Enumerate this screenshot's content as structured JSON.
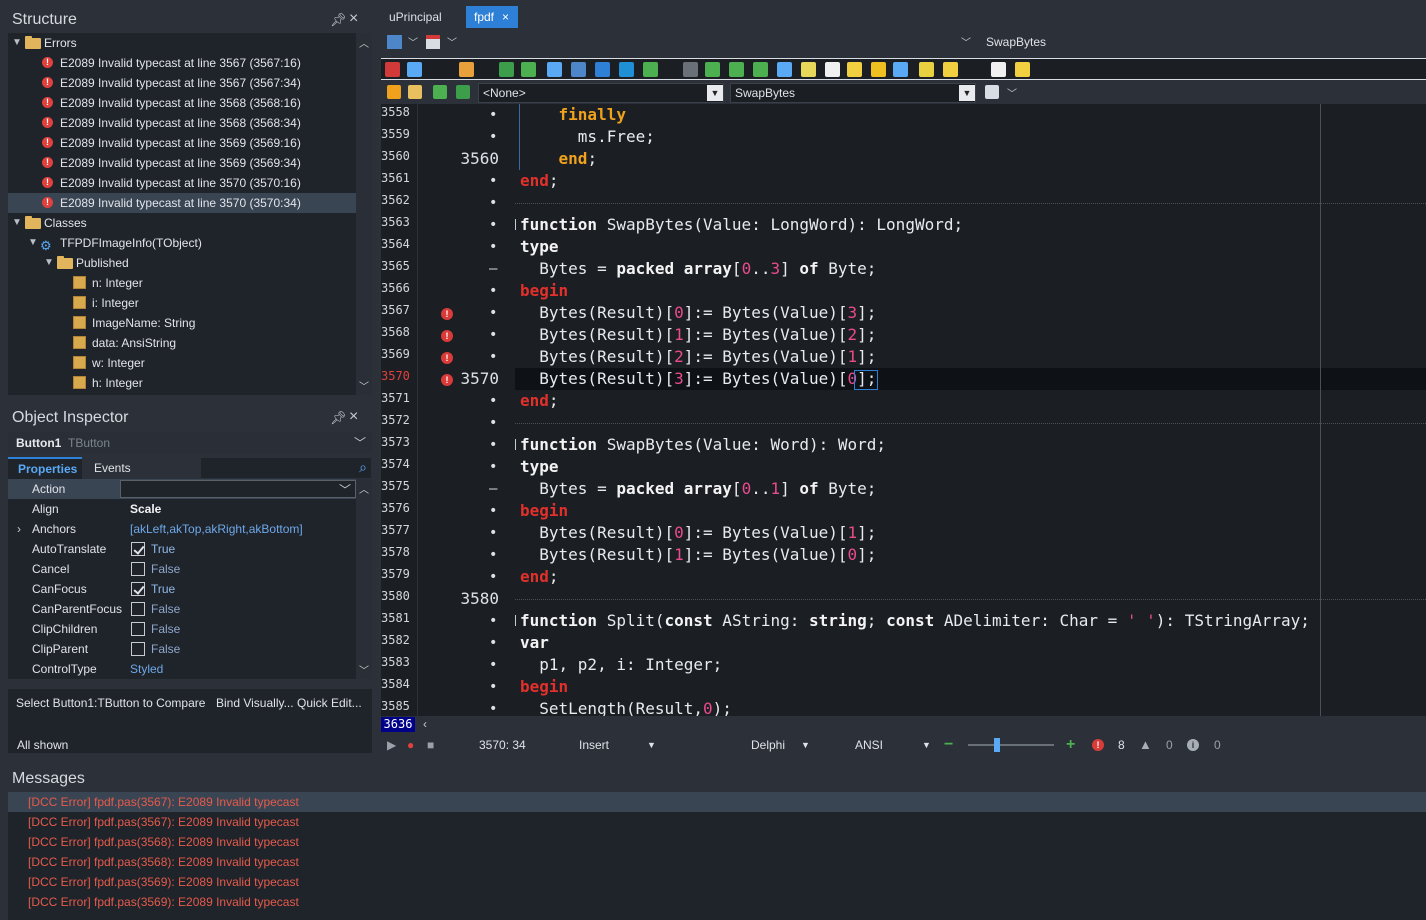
{
  "structure": {
    "title": "Structure",
    "errors_label": "Errors",
    "errors": [
      "E2089 Invalid typecast at line 3567 (3567:16)",
      "E2089 Invalid typecast at line 3567 (3567:34)",
      "E2089 Invalid typecast at line 3568 (3568:16)",
      "E2089 Invalid typecast at line 3568 (3568:34)",
      "E2089 Invalid typecast at line 3569 (3569:16)",
      "E2089 Invalid typecast at line 3569 (3569:34)",
      "E2089 Invalid typecast at line 3570 (3570:16)",
      "E2089 Invalid typecast at line 3570 (3570:34)"
    ],
    "classes_label": "Classes",
    "class_name": "TFPDFImageInfo(TObject)",
    "published_label": "Published",
    "fields": [
      "n: Integer",
      "i: Integer",
      "ImageName: String",
      "data: AnsiString",
      "w: Integer",
      "h: Integer"
    ]
  },
  "object_inspector": {
    "title": "Object Inspector",
    "component": "Button1",
    "component_type": "TButton",
    "tab_properties": "Properties",
    "tab_events": "Events",
    "properties": [
      {
        "name": "Action",
        "value": "",
        "kind": "combo"
      },
      {
        "name": "Align",
        "value": "Scale",
        "kind": "bold"
      },
      {
        "name": "Anchors",
        "value": "[akLeft,akTop,akRight,akBottom]",
        "kind": "link"
      },
      {
        "name": "AutoTranslate",
        "value": "True",
        "kind": "check",
        "checked": true
      },
      {
        "name": "Cancel",
        "value": "False",
        "kind": "check",
        "checked": false
      },
      {
        "name": "CanFocus",
        "value": "True",
        "kind": "check",
        "checked": true
      },
      {
        "name": "CanParentFocus",
        "value": "False",
        "kind": "check",
        "checked": false
      },
      {
        "name": "ClipChildren",
        "value": "False",
        "kind": "check",
        "checked": false
      },
      {
        "name": "ClipParent",
        "value": "False",
        "kind": "check",
        "checked": false
      },
      {
        "name": "ControlType",
        "value": "Styled",
        "kind": "link"
      }
    ],
    "action_compare": "Select Button1:TButton to Compare",
    "action_bind": "Bind Visually...",
    "action_quick": "Quick Edit...",
    "footer": "All shown"
  },
  "editor": {
    "tabs": [
      "uPrincipal",
      "fpdf"
    ],
    "method_nav": "SwapBytes",
    "combo_class": "<None>",
    "combo_method": "SwapBytes",
    "gutter_last": "3636",
    "lines": [
      {
        "n": "3558",
        "mark": "",
        "err": false
      },
      {
        "n": "3559",
        "mark": "",
        "err": false
      },
      {
        "n": "3560",
        "mark": "3560",
        "err": false
      },
      {
        "n": "3561",
        "mark": "",
        "err": false
      },
      {
        "n": "3562",
        "mark": "",
        "err": false
      },
      {
        "n": "3563",
        "mark": "",
        "err": false
      },
      {
        "n": "3564",
        "mark": "",
        "err": false
      },
      {
        "n": "3565",
        "mark": "",
        "err": false
      },
      {
        "n": "3566",
        "mark": "",
        "err": false
      },
      {
        "n": "3567",
        "mark": "",
        "err": true
      },
      {
        "n": "3568",
        "mark": "",
        "err": true
      },
      {
        "n": "3569",
        "mark": "",
        "err": true
      },
      {
        "n": "3570",
        "mark": "3570",
        "err": true,
        "cur": true
      },
      {
        "n": "3571",
        "mark": "",
        "err": false
      },
      {
        "n": "3572",
        "mark": "",
        "err": false
      },
      {
        "n": "3573",
        "mark": "",
        "err": false
      },
      {
        "n": "3574",
        "mark": "",
        "err": false
      },
      {
        "n": "3575",
        "mark": "",
        "err": false
      },
      {
        "n": "3576",
        "mark": "",
        "err": false
      },
      {
        "n": "3577",
        "mark": "",
        "err": false
      },
      {
        "n": "3578",
        "mark": "",
        "err": false
      },
      {
        "n": "3579",
        "mark": "",
        "err": false
      },
      {
        "n": "3580",
        "mark": "3580",
        "err": false
      },
      {
        "n": "3581",
        "mark": "",
        "err": false
      },
      {
        "n": "3582",
        "mark": "",
        "err": false
      },
      {
        "n": "3583",
        "mark": "",
        "err": false
      },
      {
        "n": "3584",
        "mark": "",
        "err": false
      },
      {
        "n": "3585",
        "mark": "",
        "err": false
      }
    ],
    "code": [
      "    <span class=\"k\">finally</span>",
      "      ms.Free;",
      "    <span class=\"k\">end</span>;",
      "<span class=\"kr\">end</span>;",
      "",
      "<span class=\"kw\">function</span> SwapBytes(Value: LongWord): LongWord;",
      "<span class=\"kw\">type</span>",
      "  Bytes = <span class=\"kw\">packed array</span>[<span class=\"n\">0</span>..<span class=\"n\">3</span>] <span class=\"kw\">of</span> Byte;",
      "<span class=\"kr\">begin</span>",
      "  Bytes(Result)[<span class=\"n\">0</span>]:= Bytes(Value)[<span class=\"n\">3</span>];",
      "  Bytes(Result)[<span class=\"n\">1</span>]:= Bytes(Value)[<span class=\"n\">2</span>];",
      "  Bytes(Result)[<span class=\"n\">2</span>]:= Bytes(Value)[<span class=\"n\">1</span>];",
      "  Bytes(Result)[<span class=\"n\">3</span>]:= Bytes(Value)[<span class=\"n\">0</span>];",
      "<span class=\"kr\">end</span>;",
      "",
      "<span class=\"kw\">function</span> SwapBytes(Value: Word): Word;",
      "<span class=\"kw\">type</span>",
      "  Bytes = <span class=\"kw\">packed array</span>[<span class=\"n\">0</span>..<span class=\"n\">1</span>] <span class=\"kw\">of</span> Byte;",
      "<span class=\"kr\">begin</span>",
      "  Bytes(Result)[<span class=\"n\">0</span>]:= Bytes(Value)[<span class=\"n\">1</span>];",
      "  Bytes(Result)[<span class=\"n\">1</span>]:= Bytes(Value)[<span class=\"n\">0</span>];",
      "<span class=\"kr\">end</span>;",
      "",
      "<span class=\"kw\">function</span> Split(<span class=\"kw\">const</span> AString: <span class=\"kw\">string</span>; <span class=\"kw\">const</span> ADelimiter: Char = <span class=\"s\">' '</span>): TStringArray;",
      "<span class=\"kw\">var</span>",
      "  p1, p2, i: Integer;",
      "<span class=\"kr\">begin</span>",
      "  SetLength(Result,<span class=\"n\">0</span>);"
    ]
  },
  "status": {
    "position": "3570:  34",
    "mode": "Insert",
    "language": "Delphi",
    "encoding": "ANSI",
    "errors": "8",
    "warnings": "0",
    "hints": "0"
  },
  "messages": {
    "title": "Messages",
    "items": [
      "[DCC Error] fpdf.pas(3567): E2089 Invalid typecast",
      "[DCC Error] fpdf.pas(3567): E2089 Invalid typecast",
      "[DCC Error] fpdf.pas(3568): E2089 Invalid typecast",
      "[DCC Error] fpdf.pas(3568): E2089 Invalid typecast",
      "[DCC Error] fpdf.pas(3569): E2089 Invalid typecast",
      "[DCC Error] fpdf.pas(3569): E2089 Invalid typecast"
    ]
  },
  "colors": {
    "error": "#e0413d",
    "accent": "#2e7fd6",
    "keyword": "#f0a21c",
    "number": "#e94b8d"
  }
}
